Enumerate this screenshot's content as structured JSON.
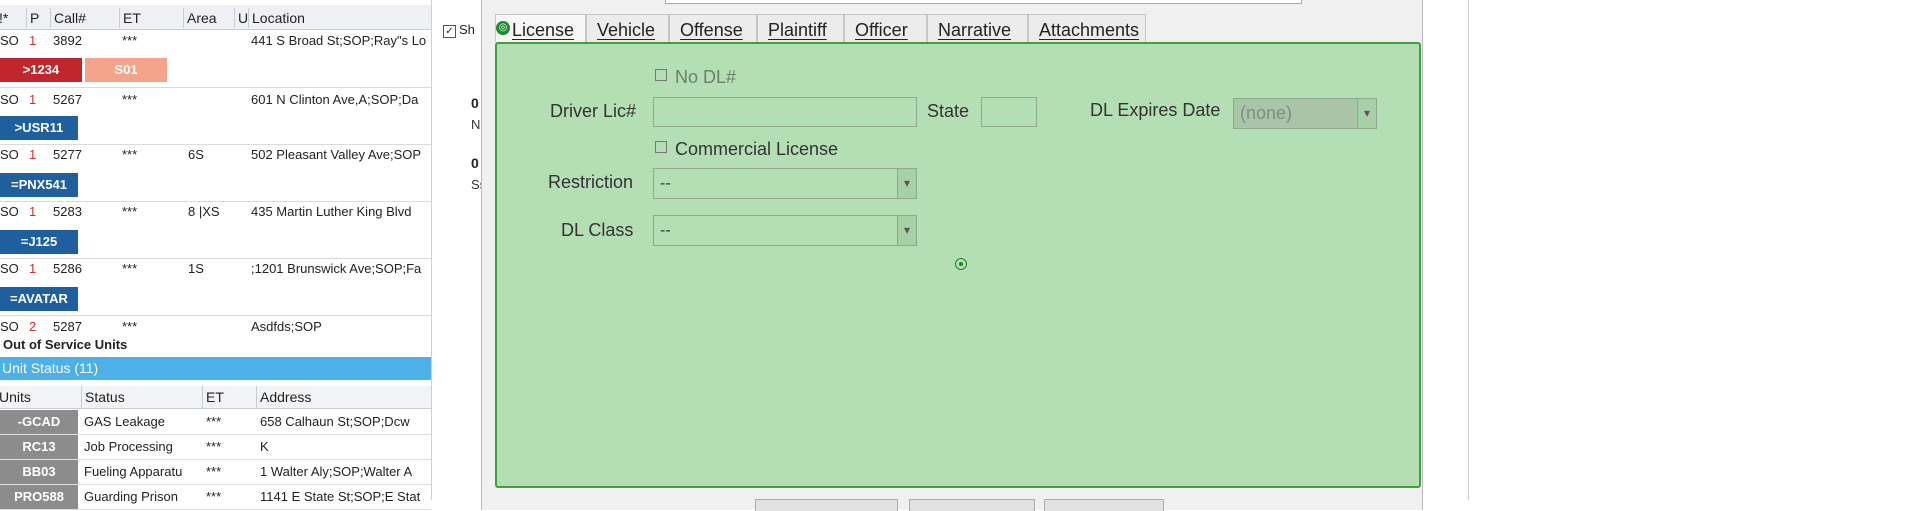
{
  "calls": {
    "headers": [
      "!*",
      "P",
      "Call#",
      "ET",
      "Area",
      "U",
      "Location"
    ],
    "rows": [
      {
        "src": "SO",
        "p": "1",
        "num": "3892",
        "et": "***",
        "area": "",
        "loc": "441 S Broad St;SOP;Ray\"s Lo",
        "tag": ">1234",
        "tag_color": "#c0272d",
        "tag2": "S01",
        "tag2_color": "#f4a48a"
      },
      {
        "src": "SO",
        "p": "1",
        "num": "5267",
        "et": "***",
        "area": "",
        "loc": "601 N Clinton Ave,A;SOP;Da",
        "tag": ">USR11",
        "tag_color": "#1f5f9e"
      },
      {
        "src": "SO",
        "p": "1",
        "num": "5277",
        "et": "***",
        "area": "6S",
        "loc": "502 Pleasant Valley Ave;SOP",
        "tag": "=PNX541",
        "tag_color": "#1f5f9e"
      },
      {
        "src": "SO",
        "p": "1",
        "num": "5283",
        "et": "***",
        "area": "8 |XS",
        "loc": "435 Martin Luther King Blvd",
        "tag": "=J125",
        "tag_color": "#1f5f9e"
      },
      {
        "src": "SO",
        "p": "1",
        "num": "5286",
        "et": "***",
        "area": "1S",
        "loc": ";1201 Brunswick Ave;SOP;Fa",
        "tag": "=AVATAR",
        "tag_color": "#1f5f9e"
      },
      {
        "src": "SO",
        "p": "2",
        "num": "5287",
        "et": "***",
        "area": "",
        "loc": "Asdfds;SOP"
      }
    ]
  },
  "out_of_service": "Out of Service Units",
  "unit_status_title": "Unit Status (11)",
  "units": {
    "headers": [
      "Units",
      "Status",
      "ET",
      "Address"
    ],
    "rows": [
      {
        "name": "-GCAD",
        "status": "GAS Leakage",
        "et": "***",
        "addr": "658 Calhaun St;SOP;Dcw"
      },
      {
        "name": "RC13",
        "status": "Job Processing",
        "et": "***",
        "addr": "K"
      },
      {
        "name": "BB03",
        "status": "Fueling Apparatu",
        "et": "***",
        "addr": "1 Walter Aly;SOP;Walter A"
      },
      {
        "name": "PRO588",
        "status": "Guarding Prison",
        "et": "***",
        "addr": "1141 E State St;SOP;E Stat"
      }
    ]
  },
  "background": {
    "checkbox_label": "Sh",
    "items": [
      {
        "bold": "0",
        "small": "N"
      },
      {
        "bold": "0",
        "small": "Ss"
      }
    ]
  },
  "dialog": {
    "tabs": [
      {
        "label": "License",
        "active": true
      },
      {
        "label": "Vehicle"
      },
      {
        "label": "Offense"
      },
      {
        "label": "Plaintiff"
      },
      {
        "label": "Officer"
      },
      {
        "label": "Narrative"
      },
      {
        "label": "Attachments"
      }
    ],
    "no_dl_label": "No DL#",
    "driver_lic_label": "Driver Lic#",
    "driver_lic_value": "",
    "state_label": "State",
    "state_value": "",
    "dl_expires_label": "DL Expires Date",
    "dl_expires_value": "(none)",
    "commercial_label": "Commercial License",
    "restriction_label": "Restriction",
    "restriction_value": "--",
    "dl_class_label": "DL Class",
    "dl_class_value": "--"
  },
  "colors": {
    "panel_bg": "#b4deb4",
    "panel_border": "#3fa03f",
    "unit_status_bar": "#4db1e8",
    "priority_red": "#d62b2b"
  }
}
